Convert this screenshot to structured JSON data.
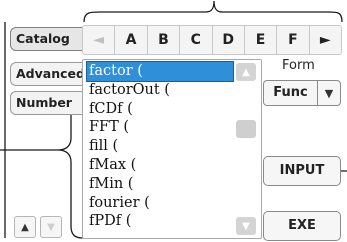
{
  "letter_strip": {
    "cells": [
      {
        "label": "◄",
        "enabled": false
      },
      {
        "label": "A",
        "enabled": true
      },
      {
        "label": "B",
        "enabled": true
      },
      {
        "label": "C",
        "enabled": true
      },
      {
        "label": "D",
        "enabled": true
      },
      {
        "label": "E",
        "enabled": true
      },
      {
        "label": "F",
        "enabled": true
      },
      {
        "label": "►",
        "enabled": true
      }
    ]
  },
  "tabs": [
    {
      "label": "Catalog",
      "active": true
    },
    {
      "label": "Advanced",
      "active": false
    },
    {
      "label": "Number",
      "active": false
    }
  ],
  "function_list": {
    "items": [
      "factor (",
      "factorOut (",
      "fCDf (",
      "FFT (",
      "fill (",
      "fMax (",
      "fMin (",
      "fourier (",
      "fPDf ("
    ],
    "selected_index": 0,
    "scroll_up_icon": "▲",
    "scroll_down_icon": "▼"
  },
  "form": {
    "label": "Form",
    "value": "Func",
    "arrow_icon": "▼"
  },
  "buttons": {
    "input": "INPUT",
    "exe": "EXE"
  },
  "tab_scroll": {
    "up_icon": "▲",
    "down_icon": "▼"
  },
  "colors": {
    "selection": "#2f8fd8",
    "callout": "#1a1a1a"
  }
}
